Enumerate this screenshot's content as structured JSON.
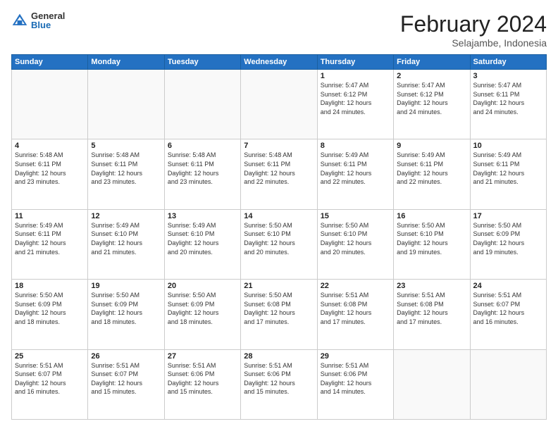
{
  "logo": {
    "general": "General",
    "blue": "Blue"
  },
  "title": "February 2024",
  "location": "Selajambe, Indonesia",
  "days_of_week": [
    "Sunday",
    "Monday",
    "Tuesday",
    "Wednesday",
    "Thursday",
    "Friday",
    "Saturday"
  ],
  "weeks": [
    [
      {
        "day": "",
        "info": ""
      },
      {
        "day": "",
        "info": ""
      },
      {
        "day": "",
        "info": ""
      },
      {
        "day": "",
        "info": ""
      },
      {
        "day": "1",
        "info": "Sunrise: 5:47 AM\nSunset: 6:12 PM\nDaylight: 12 hours\nand 24 minutes."
      },
      {
        "day": "2",
        "info": "Sunrise: 5:47 AM\nSunset: 6:12 PM\nDaylight: 12 hours\nand 24 minutes."
      },
      {
        "day": "3",
        "info": "Sunrise: 5:47 AM\nSunset: 6:11 PM\nDaylight: 12 hours\nand 24 minutes."
      }
    ],
    [
      {
        "day": "4",
        "info": "Sunrise: 5:48 AM\nSunset: 6:11 PM\nDaylight: 12 hours\nand 23 minutes."
      },
      {
        "day": "5",
        "info": "Sunrise: 5:48 AM\nSunset: 6:11 PM\nDaylight: 12 hours\nand 23 minutes."
      },
      {
        "day": "6",
        "info": "Sunrise: 5:48 AM\nSunset: 6:11 PM\nDaylight: 12 hours\nand 23 minutes."
      },
      {
        "day": "7",
        "info": "Sunrise: 5:48 AM\nSunset: 6:11 PM\nDaylight: 12 hours\nand 22 minutes."
      },
      {
        "day": "8",
        "info": "Sunrise: 5:49 AM\nSunset: 6:11 PM\nDaylight: 12 hours\nand 22 minutes."
      },
      {
        "day": "9",
        "info": "Sunrise: 5:49 AM\nSunset: 6:11 PM\nDaylight: 12 hours\nand 22 minutes."
      },
      {
        "day": "10",
        "info": "Sunrise: 5:49 AM\nSunset: 6:11 PM\nDaylight: 12 hours\nand 21 minutes."
      }
    ],
    [
      {
        "day": "11",
        "info": "Sunrise: 5:49 AM\nSunset: 6:11 PM\nDaylight: 12 hours\nand 21 minutes."
      },
      {
        "day": "12",
        "info": "Sunrise: 5:49 AM\nSunset: 6:10 PM\nDaylight: 12 hours\nand 21 minutes."
      },
      {
        "day": "13",
        "info": "Sunrise: 5:49 AM\nSunset: 6:10 PM\nDaylight: 12 hours\nand 20 minutes."
      },
      {
        "day": "14",
        "info": "Sunrise: 5:50 AM\nSunset: 6:10 PM\nDaylight: 12 hours\nand 20 minutes."
      },
      {
        "day": "15",
        "info": "Sunrise: 5:50 AM\nSunset: 6:10 PM\nDaylight: 12 hours\nand 20 minutes."
      },
      {
        "day": "16",
        "info": "Sunrise: 5:50 AM\nSunset: 6:10 PM\nDaylight: 12 hours\nand 19 minutes."
      },
      {
        "day": "17",
        "info": "Sunrise: 5:50 AM\nSunset: 6:09 PM\nDaylight: 12 hours\nand 19 minutes."
      }
    ],
    [
      {
        "day": "18",
        "info": "Sunrise: 5:50 AM\nSunset: 6:09 PM\nDaylight: 12 hours\nand 18 minutes."
      },
      {
        "day": "19",
        "info": "Sunrise: 5:50 AM\nSunset: 6:09 PM\nDaylight: 12 hours\nand 18 minutes."
      },
      {
        "day": "20",
        "info": "Sunrise: 5:50 AM\nSunset: 6:09 PM\nDaylight: 12 hours\nand 18 minutes."
      },
      {
        "day": "21",
        "info": "Sunrise: 5:50 AM\nSunset: 6:08 PM\nDaylight: 12 hours\nand 17 minutes."
      },
      {
        "day": "22",
        "info": "Sunrise: 5:51 AM\nSunset: 6:08 PM\nDaylight: 12 hours\nand 17 minutes."
      },
      {
        "day": "23",
        "info": "Sunrise: 5:51 AM\nSunset: 6:08 PM\nDaylight: 12 hours\nand 17 minutes."
      },
      {
        "day": "24",
        "info": "Sunrise: 5:51 AM\nSunset: 6:07 PM\nDaylight: 12 hours\nand 16 minutes."
      }
    ],
    [
      {
        "day": "25",
        "info": "Sunrise: 5:51 AM\nSunset: 6:07 PM\nDaylight: 12 hours\nand 16 minutes."
      },
      {
        "day": "26",
        "info": "Sunrise: 5:51 AM\nSunset: 6:07 PM\nDaylight: 12 hours\nand 15 minutes."
      },
      {
        "day": "27",
        "info": "Sunrise: 5:51 AM\nSunset: 6:06 PM\nDaylight: 12 hours\nand 15 minutes."
      },
      {
        "day": "28",
        "info": "Sunrise: 5:51 AM\nSunset: 6:06 PM\nDaylight: 12 hours\nand 15 minutes."
      },
      {
        "day": "29",
        "info": "Sunrise: 5:51 AM\nSunset: 6:06 PM\nDaylight: 12 hours\nand 14 minutes."
      },
      {
        "day": "",
        "info": ""
      },
      {
        "day": "",
        "info": ""
      }
    ]
  ]
}
